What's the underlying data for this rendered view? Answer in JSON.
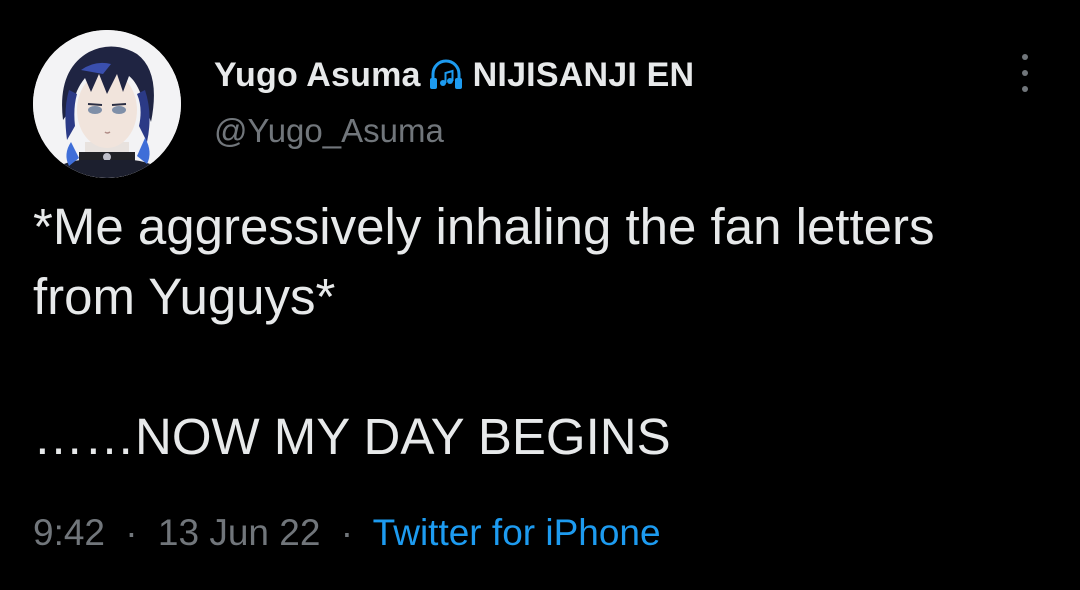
{
  "author": {
    "display_name": "Yugo Asuma",
    "badge_icon": "headphones-icon",
    "affiliation": "NIJISANJI EN",
    "handle": "@Yugo_Asuma"
  },
  "tweet": {
    "text": "*Me aggressively inhaling the fan letters from Yuguys*\n\n……NOW MY DAY BEGINS"
  },
  "meta": {
    "time": "9:42",
    "separator": "·",
    "date": "13 Jun 22",
    "source": "Twitter for iPhone"
  },
  "colors": {
    "background": "#000000",
    "primary_text": "#e7e9ea",
    "secondary_text": "#71767b",
    "link": "#1d9bf0",
    "icon_accent": "#1d9bf0"
  },
  "menu": {
    "more_icon": "more-vertical-icon"
  }
}
